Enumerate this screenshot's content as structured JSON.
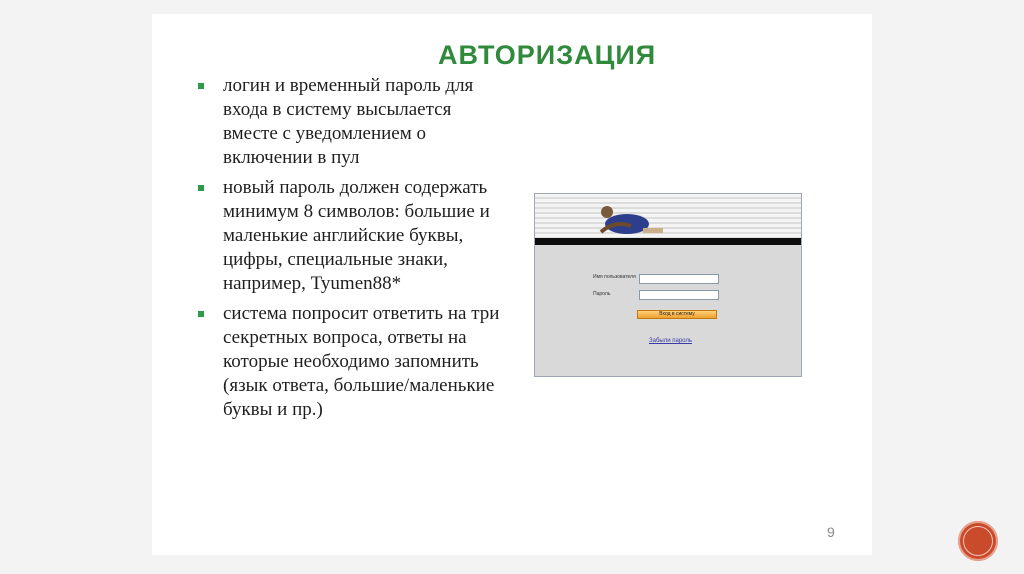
{
  "slide": {
    "title": "АВТОРИЗАЦИЯ",
    "bullets": [
      "логин и временный пароль для входа в систему высылается вместе с уведомлением о включении в пул",
      "новый пароль должен содержать минимум 8 символов: большие и маленькие английские буквы, цифры, специальные знаки, например, Tyumen88*",
      "система попросит ответить на три секретных вопроса, ответы на которые необходимо запомнить (язык ответа, большие/маленькие буквы и пр.)"
    ],
    "page_number": "9"
  },
  "login_screenshot": {
    "username_label": "Имя пользователя",
    "password_label": "Пароль",
    "login_button": "Вход в систему",
    "forgot_password": "Забыли пароль"
  },
  "colors": {
    "title": "#2f8a3c",
    "bullet_marker": "#2f9a4a",
    "nav_circle": "#c94b2b"
  }
}
